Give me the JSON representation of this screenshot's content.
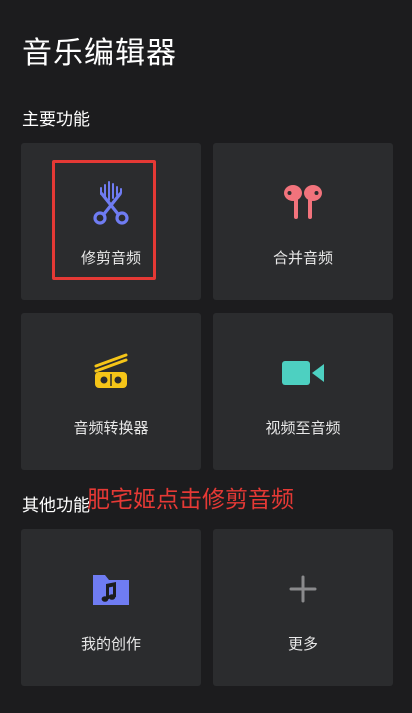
{
  "app": {
    "title": "音乐编辑器"
  },
  "sections": {
    "main": "主要功能",
    "other": "其他功能"
  },
  "tiles": {
    "trim": {
      "label": "修剪音频",
      "icon": "scissors-waveform-icon",
      "color": "#6f7cf2"
    },
    "merge": {
      "label": "合并音频",
      "icon": "earbuds-icon",
      "color": "#f2737c"
    },
    "convert": {
      "label": "音频转换器",
      "icon": "converter-icon",
      "color": "#f5c518"
    },
    "video_to_audio": {
      "label": "视频至音频",
      "icon": "video-camera-icon",
      "color": "#4dd0c1"
    },
    "my_works": {
      "label": "我的创作",
      "icon": "music-folder-icon",
      "color": "#6f7cf2"
    },
    "more": {
      "label": "更多",
      "icon": "plus-icon",
      "color": "#8a8a8c"
    }
  },
  "annotation": {
    "text": "肥宅姬点击修剪音频",
    "color": "#e53935"
  }
}
